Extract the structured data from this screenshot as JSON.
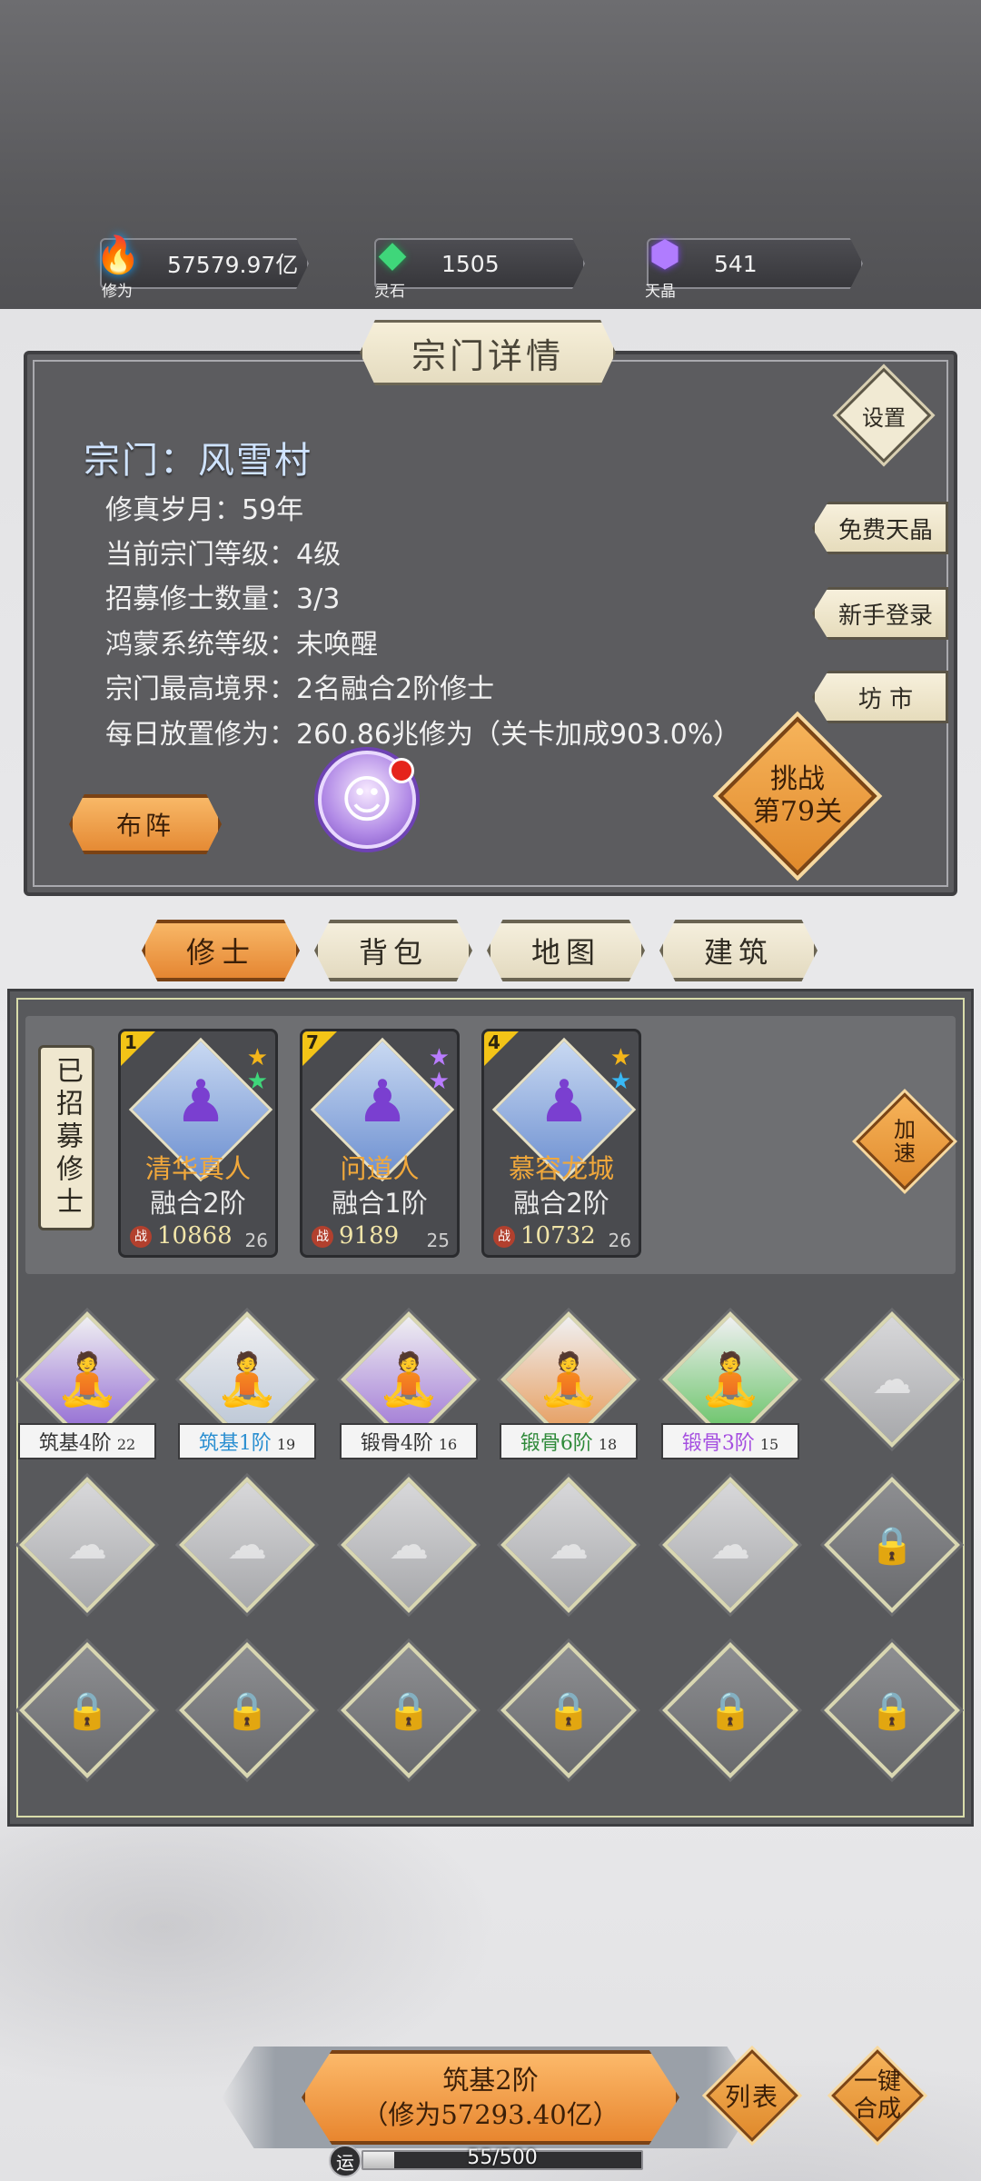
{
  "resources": [
    {
      "icon": "flame-icon",
      "label": "修为",
      "value": "57579.97亿"
    },
    {
      "icon": "crystal-icon",
      "label": "灵石",
      "value": "1505"
    },
    {
      "icon": "gem-icon",
      "label": "天晶",
      "value": "541"
    }
  ],
  "panel": {
    "title": "宗门详情",
    "sect_name": "宗门：风雪村",
    "info": [
      "修真岁月：59年",
      "当前宗门等级：4级",
      "招募修士数量：3/3",
      "鸿蒙系统等级：未唤醒",
      "宗门最高境界：2名融合2阶修士",
      "每日放置修为：260.86兆修为（关卡加成903.0%）"
    ],
    "settings_label": "设置",
    "side_buttons": [
      "免费天晶",
      "新手登录",
      "坊 市"
    ],
    "challenge_line1": "挑战",
    "challenge_line2": "第79关",
    "formation_label": "布阵"
  },
  "tabs": [
    "修士",
    "背包",
    "地图",
    "建筑"
  ],
  "active_tab": "修士",
  "recruited_label": "已招募修士",
  "speed_line1": "加",
  "speed_line2": "速",
  "recruited_cards": [
    {
      "slot_num": "1",
      "name": "清华真人",
      "stage": "融合2阶",
      "power": "10868",
      "level": "26",
      "stars": [
        "#f3b51a",
        "#3fd67a"
      ]
    },
    {
      "slot_num": "7",
      "name": "问道人",
      "stage": "融合1阶",
      "power": "9189",
      "level": "25",
      "stars": [
        "#b97cff",
        "#b97cff"
      ]
    },
    {
      "slot_num": "4",
      "name": "慕容龙城",
      "stage": "融合2阶",
      "power": "10732",
      "level": "26",
      "stars": [
        "#f3b51a",
        "#38b8f5"
      ]
    }
  ],
  "grid_units": [
    {
      "tag": "筑基4阶",
      "level": "22",
      "color": "#333333",
      "bg": "#8a5fd0"
    },
    {
      "tag": "筑基1阶",
      "level": "19",
      "color": "#2b8fd1",
      "bg": "#b7c3d3"
    },
    {
      "tag": "锻骨4阶",
      "level": "16",
      "color": "#333333",
      "bg": "#9a6fd3"
    },
    {
      "tag": "锻骨6阶",
      "level": "18",
      "color": "#2f8a3a",
      "bg": "#e59550"
    },
    {
      "tag": "锻骨3阶",
      "level": "15",
      "color": "#a54fe0",
      "bg": "#5cbf5a"
    }
  ],
  "bottom": {
    "main_line1": "筑基2阶",
    "main_line2": "（修为57293.40亿）",
    "list_label": "列表",
    "merge_line1": "一键",
    "merge_line2": "合成",
    "luck_label": "运",
    "progress_text": "55/500",
    "progress_fraction": 0.11
  }
}
